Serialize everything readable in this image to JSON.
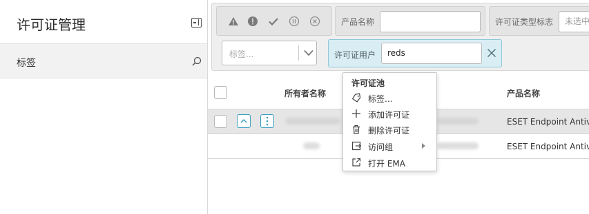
{
  "sidebar": {
    "title": "许可证管理",
    "tag_item": "标签",
    "icons": {
      "collapse": "collapse-panel-icon",
      "search": "search-icon"
    }
  },
  "filters": {
    "status_icons": [
      "warning-icon",
      "error-icon",
      "check-icon",
      "pause-icon",
      "close-circle-icon"
    ],
    "product_name_label": "产品名称",
    "product_name_value": "",
    "license_type_label": "许可证类型标志",
    "license_type_placeholder": "未选中",
    "tag_placeholder": "标签...",
    "license_user_label": "许可证用户",
    "license_user_value": "reds"
  },
  "table": {
    "columns": [
      "所有者名称",
      "产品名称"
    ],
    "rows": [
      {
        "product": "ESET Endpoint Antivirus",
        "selected": true
      },
      {
        "product": "ESET Endpoint Antivirus",
        "selected": false
      }
    ]
  },
  "context_menu": {
    "header": "许可证池",
    "items": [
      {
        "label": "标签...",
        "icon": "tag-icon"
      },
      {
        "label": "添加许可证",
        "icon": "plus-icon"
      },
      {
        "label": "删除许可证",
        "icon": "trash-icon"
      },
      {
        "label": "访问组",
        "icon": "folder-access-icon",
        "submenu": true
      },
      {
        "label": "打开 EMA",
        "icon": "external-link-icon"
      }
    ]
  },
  "colors": {
    "accent": "#3d9fbf",
    "filter_active_bg": "#d9eef4"
  }
}
